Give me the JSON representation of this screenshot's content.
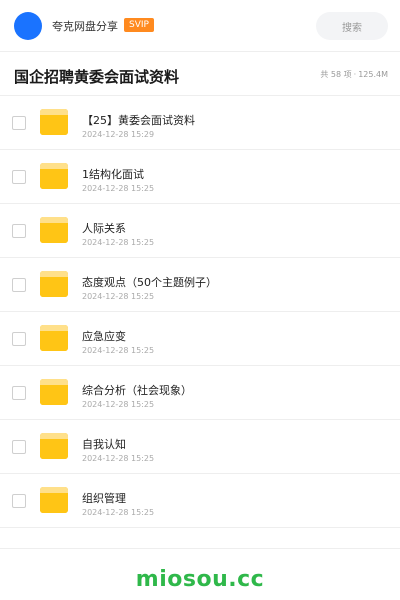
{
  "header": {
    "brand": "夸克网盘分享",
    "badge": "SVIP",
    "search_label": "搜索",
    "accent": "#1a73ff",
    "badge_color": "#ff8a1f"
  },
  "title_bar": {
    "title": "国企招聘黄委会面试资料",
    "count": "共 58 项",
    "separator": "·",
    "size": "125.4M"
  },
  "items": [
    {
      "name": "【25】黄委会面试资料",
      "date": "2024-12-28 15:29",
      "icon": "folder-icon"
    },
    {
      "name": "1结构化面试",
      "date": "2024-12-28 15:25",
      "icon": "folder-icon"
    },
    {
      "name": "人际关系",
      "date": "2024-12-28 15:25",
      "icon": "folder-icon"
    },
    {
      "name": "态度观点（50个主题例子）",
      "date": "2024-12-28 15:25",
      "icon": "folder-icon"
    },
    {
      "name": "应急应变",
      "date": "2024-12-28 15:25",
      "icon": "folder-icon"
    },
    {
      "name": "综合分析（社会现象）",
      "date": "2024-12-28 15:25",
      "icon": "folder-icon"
    },
    {
      "name": "自我认知",
      "date": "2024-12-28 15:25",
      "icon": "folder-icon"
    },
    {
      "name": "组织管理",
      "date": "2024-12-28 15:25",
      "icon": "folder-icon"
    }
  ],
  "footer": {
    "watermark": "miosou.cc",
    "watermark_color": "#2fb84a"
  }
}
